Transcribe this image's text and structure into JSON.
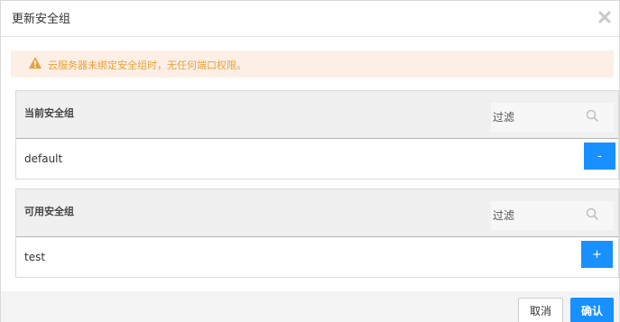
{
  "dialog": {
    "title": "更新安全组",
    "close_icon": "close-icon"
  },
  "alert": {
    "icon": "warning-icon",
    "message": "云服务器未绑定安全组时，无任何端口权限。",
    "color": "#e6a23c"
  },
  "current_group": {
    "label": "当前安全组",
    "filter_placeholder": "过滤",
    "items": [
      {
        "name": "default",
        "action_label": "-"
      }
    ]
  },
  "available_group": {
    "label": "可用安全组",
    "filter_placeholder": "过滤",
    "items": [
      {
        "name": "test",
        "action_label": "+"
      }
    ]
  },
  "footer": {
    "cancel_label": "取消",
    "confirm_label": "确认"
  },
  "colors": {
    "primary": "#1890ff",
    "alert_bg": "#fdefe6",
    "warning": "#e6a23c"
  }
}
